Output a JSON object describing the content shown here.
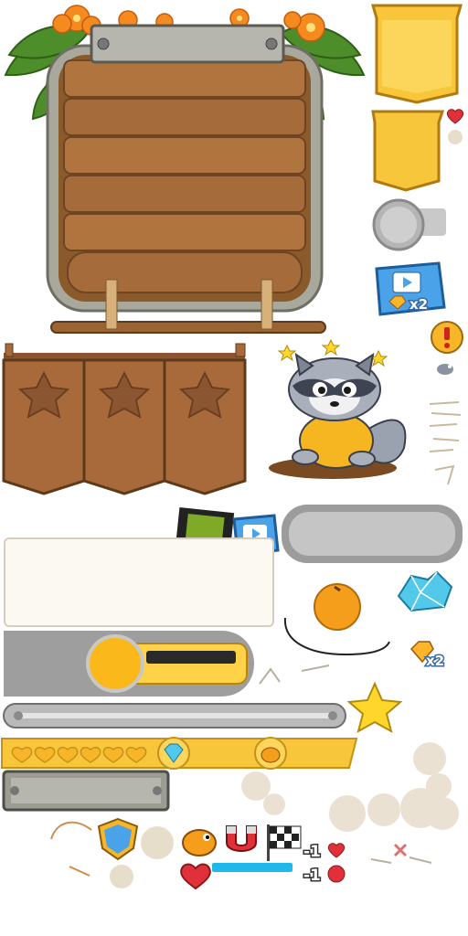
{
  "sprite_sheet": {
    "board_title_plate": "",
    "multiplier_labels": {
      "video_gems": "x2",
      "gem_pickup": "x2"
    },
    "penalty_labels": {
      "heart": "-1",
      "energy": "-1"
    },
    "progress_bar": {
      "heart_slots": 6,
      "icons": [
        "diamond-icon",
        "bird-icon"
      ]
    },
    "powerups": [
      "shield-icon",
      "bird-icon",
      "magnet-icon",
      "checkered-flag-icon"
    ],
    "colors": {
      "wood": "#a56b3a",
      "wood_dark": "#6e4423",
      "frame": "#9a9a8c",
      "gold": "#f7c63a",
      "gold_dark": "#d69c1b",
      "blue_badge": "#4aa3e8",
      "heart_red": "#e0303a",
      "energy_blue": "#1fb8e8"
    }
  }
}
